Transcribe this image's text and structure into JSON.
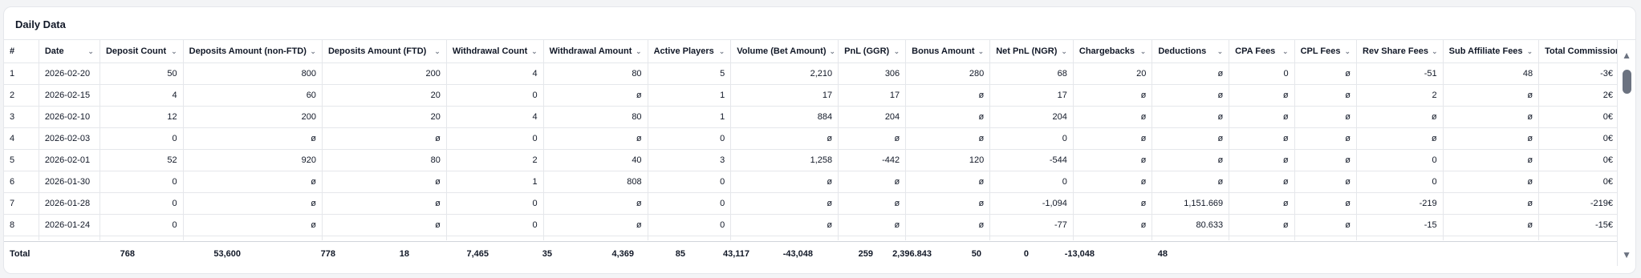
{
  "title": "Daily Data",
  "columns": [
    {
      "label": "#",
      "sortable": false
    },
    {
      "label": "Date",
      "sortable": true
    },
    {
      "label": "Deposit Count",
      "sortable": true
    },
    {
      "label": "Deposits Amount (non-FTD)",
      "sortable": true
    },
    {
      "label": "Deposits Amount (FTD)",
      "sortable": true
    },
    {
      "label": "Withdrawal Count",
      "sortable": true
    },
    {
      "label": "Withdrawal Amount",
      "sortable": true
    },
    {
      "label": "Active Players",
      "sortable": true
    },
    {
      "label": "Volume (Bet Amount)",
      "sortable": true
    },
    {
      "label": "PnL (GGR)",
      "sortable": true
    },
    {
      "label": "Bonus Amount",
      "sortable": true
    },
    {
      "label": "Net PnL (NGR)",
      "sortable": true
    },
    {
      "label": "Chargebacks",
      "sortable": true
    },
    {
      "label": "Deductions",
      "sortable": true
    },
    {
      "label": "CPA Fees",
      "sortable": true
    },
    {
      "label": "CPL Fees",
      "sortable": true
    },
    {
      "label": "Rev Share Fees",
      "sortable": true
    },
    {
      "label": "Sub Affiliate Fees",
      "sortable": true
    },
    {
      "label": "Total Commission",
      "sortable": true
    }
  ],
  "rows": [
    [
      "1",
      "2026-02-20",
      "50",
      "800",
      "200",
      "4",
      "80",
      "5",
      "2,210",
      "306",
      "280",
      "68",
      "20",
      "ø",
      "0",
      "ø",
      "-51",
      "48",
      "-3€"
    ],
    [
      "2",
      "2026-02-15",
      "4",
      "60",
      "20",
      "0",
      "ø",
      "1",
      "17",
      "17",
      "ø",
      "17",
      "ø",
      "ø",
      "ø",
      "ø",
      "2",
      "ø",
      "2€"
    ],
    [
      "3",
      "2026-02-10",
      "12",
      "200",
      "20",
      "4",
      "80",
      "1",
      "884",
      "204",
      "ø",
      "204",
      "ø",
      "ø",
      "ø",
      "ø",
      "ø",
      "ø",
      "0€"
    ],
    [
      "4",
      "2026-02-03",
      "0",
      "ø",
      "ø",
      "0",
      "ø",
      "0",
      "ø",
      "ø",
      "ø",
      "0",
      "ø",
      "ø",
      "ø",
      "ø",
      "ø",
      "ø",
      "0€"
    ],
    [
      "5",
      "2026-02-01",
      "52",
      "920",
      "80",
      "2",
      "40",
      "3",
      "1,258",
      "-442",
      "120",
      "-544",
      "ø",
      "ø",
      "ø",
      "ø",
      "0",
      "ø",
      "0€"
    ],
    [
      "6",
      "2026-01-30",
      "0",
      "ø",
      "ø",
      "1",
      "808",
      "0",
      "ø",
      "ø",
      "ø",
      "0",
      "ø",
      "ø",
      "ø",
      "ø",
      "0",
      "ø",
      "0€"
    ],
    [
      "7",
      "2026-01-28",
      "0",
      "ø",
      "ø",
      "0",
      "ø",
      "0",
      "ø",
      "ø",
      "ø",
      "-1,094",
      "ø",
      "1,151.669",
      "ø",
      "ø",
      "-219",
      "ø",
      "-219€"
    ],
    [
      "8",
      "2026-01-24",
      "0",
      "ø",
      "ø",
      "0",
      "ø",
      "0",
      "ø",
      "ø",
      "ø",
      "-77",
      "ø",
      "80.633",
      "ø",
      "ø",
      "-15",
      "ø",
      "-15€"
    ],
    [
      "",
      "",
      "",
      "",
      "",
      "",
      "",
      "",
      "",
      "",
      "",
      "",
      "",
      "",
      "",
      "",
      "",
      "",
      ""
    ]
  ],
  "totals": [
    "Total",
    "",
    "768",
    "53,600",
    "778",
    "18",
    "7,465",
    "35",
    "4,369",
    "85",
    "43,117",
    "-43,048",
    "259",
    "2,396.843",
    "50",
    "0",
    "-13,048",
    "48",
    ""
  ],
  "icons": {
    "sort": "chevron-down-icon",
    "scroll_up": "triangle-up-icon",
    "scroll_down": "triangle-down-icon"
  }
}
